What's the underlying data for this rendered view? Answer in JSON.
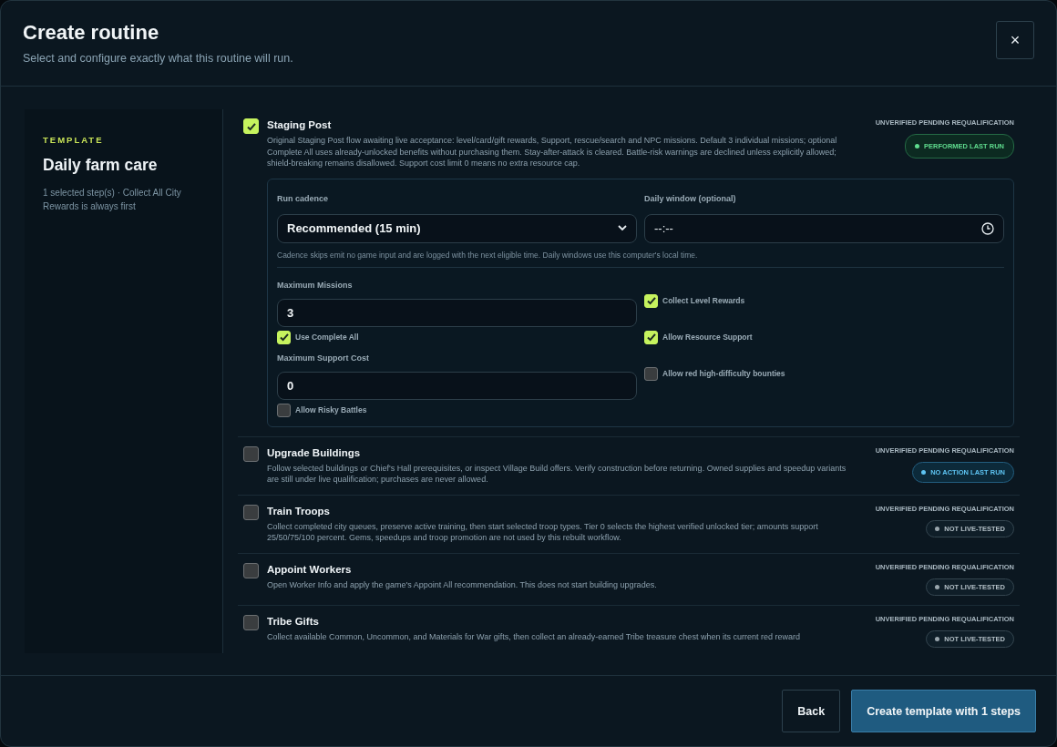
{
  "header": {
    "title": "Create routine",
    "subtitle": "Select and configure exactly what this routine will run.",
    "close": "×"
  },
  "template": {
    "eyebrow": "TEMPLATE",
    "name": "Daily farm care",
    "summary": "1 selected step(s) · Collect All City Rewards is always first"
  },
  "steps": [
    {
      "title": "Staging Post",
      "checked": true,
      "description": "Original Staging Post flow awaiting live acceptance: level/card/gift rewards, Support, rescue/search and NPC missions. Default 3 individual missions; optional Complete All uses already-unlocked benefits without purchasing them. Stay-after-attack is cleared. Battle-risk warnings are declined unless explicitly allowed; shield-breaking remains disallowed. Support cost limit 0 means no extra resource cap.",
      "qualification": "UNVERIFIED PENDING REQUALIFICATION",
      "status": {
        "kind": "performed",
        "label": "PERFORMED LAST RUN"
      },
      "config": {
        "cadence_label": "Run cadence",
        "cadence_value": "Recommended (15 min)",
        "window_label": "Daily window (optional)",
        "window_value": "--:--",
        "hint": "Cadence skips emit no game input and are logged with the next eligible time. Daily windows use this computer's local time.",
        "options": [
          {
            "kind": "field",
            "label": "Maximum Missions",
            "value": "3"
          },
          {
            "kind": "checkbox",
            "label": "Collect Level Rewards",
            "checked": true
          },
          {
            "kind": "checkbox",
            "label": "Use Complete All",
            "checked": true
          },
          {
            "kind": "checkbox",
            "label": "Allow Resource Support",
            "checked": true
          },
          {
            "kind": "field",
            "label": "Maximum Support Cost",
            "value": "0"
          },
          {
            "kind": "checkbox",
            "label": "Allow red high-difficulty bounties",
            "checked": false
          },
          {
            "kind": "checkbox",
            "label": "Allow Risky Battles",
            "checked": false
          }
        ]
      }
    },
    {
      "title": "Upgrade Buildings",
      "checked": false,
      "description": "Follow selected buildings or Chief's Hall prerequisites, or inspect Village Build offers. Verify construction before returning. Owned supplies and speedup variants are still under live qualification; purchases are never allowed.",
      "qualification": "UNVERIFIED PENDING REQUALIFICATION",
      "status": {
        "kind": "no-action",
        "label": "NO ACTION LAST RUN"
      }
    },
    {
      "title": "Train Troops",
      "checked": false,
      "description": "Collect completed city queues, preserve active training, then start selected troop types. Tier 0 selects the highest verified unlocked tier; amounts support 25/50/75/100 percent. Gems, speedups and troop promotion are not used by this rebuilt workflow.",
      "qualification": "UNVERIFIED PENDING REQUALIFICATION",
      "status": {
        "kind": "untested",
        "label": "NOT LIVE-TESTED"
      }
    },
    {
      "title": "Appoint Workers",
      "checked": false,
      "description": "Open Worker Info and apply the game's Appoint All recommendation. This does not start building upgrades.",
      "qualification": "UNVERIFIED PENDING REQUALIFICATION",
      "status": {
        "kind": "untested",
        "label": "NOT LIVE-TESTED"
      }
    },
    {
      "title": "Tribe Gifts",
      "checked": false,
      "description": "Collect available Common, Uncommon, and Materials for War gifts, then collect an already-earned Tribe treasure chest when its current red reward",
      "qualification": "UNVERIFIED PENDING REQUALIFICATION",
      "status": {
        "kind": "untested",
        "label": "NOT LIVE-TESTED"
      }
    }
  ],
  "footer": {
    "back": "Back",
    "create": "Create template with 1 steps"
  }
}
